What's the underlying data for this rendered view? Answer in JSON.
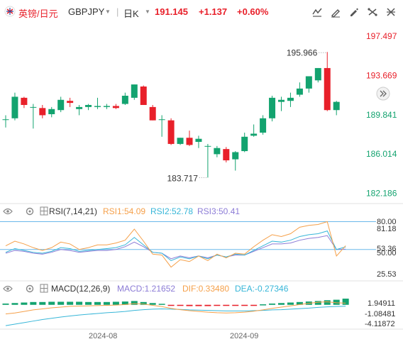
{
  "header": {
    "pair_cn": "英镑/日元",
    "symbol": "GBPJPY",
    "period": "日K",
    "price": "191.145",
    "change": "+1.137",
    "change_pct": "+0.60%"
  },
  "colors": {
    "up": "#13a36f",
    "down": "#e8202a",
    "header_red": "#e8202a",
    "price_axis_up": "#13a36f",
    "price_axis_down": "#e8202a",
    "rsi1": "#f5a04a",
    "rsi2": "#37b6d8",
    "rsi3": "#8c7cd6",
    "rsi_line": "#6ab8ea",
    "dif": "#f5a04a",
    "dea": "#37b6d8"
  },
  "price_axis": {
    "ticks": [
      "197.497",
      "193.669",
      "189.841",
      "186.014",
      "182.186"
    ],
    "high_label": "195.966",
    "low_label": "183.717"
  },
  "rsi_panel": {
    "title": "RSI(7,14,21)",
    "rsi1_label": "RSI1:54.09",
    "rsi2_label": "RSI2:52.78",
    "rsi3_label": "RSI3:50.41",
    "ticks": [
      "80.00",
      "81.18",
      "53.36",
      "50.00",
      "25.53"
    ]
  },
  "macd_panel": {
    "title": "MACD(12,26,9)",
    "macd_label": "MACD:1.21652",
    "dif_label": "DIF:0.33480",
    "dea_label": "DEA:-0.27346",
    "ticks": [
      "1.94911",
      "-1.08481",
      "-4.11872"
    ]
  },
  "x_axis": {
    "labels": [
      "2024-08",
      "2024-09"
    ]
  },
  "chart_data": {
    "type": "candlestick",
    "symbol": "GBPJPY",
    "candles": [
      {
        "o": 189.4,
        "h": 189.8,
        "l": 188.6,
        "c": 189.4
      },
      {
        "o": 189.5,
        "h": 192.0,
        "l": 189.3,
        "c": 191.6
      },
      {
        "o": 191.5,
        "h": 191.6,
        "l": 190.5,
        "c": 190.8
      },
      {
        "o": 190.6,
        "h": 190.9,
        "l": 188.5,
        "c": 190.6
      },
      {
        "o": 190.5,
        "h": 190.8,
        "l": 189.5,
        "c": 189.8
      },
      {
        "o": 189.9,
        "h": 190.6,
        "l": 189.6,
        "c": 190.4
      },
      {
        "o": 190.3,
        "h": 191.6,
        "l": 190.1,
        "c": 191.3
      },
      {
        "o": 191.2,
        "h": 191.5,
        "l": 190.6,
        "c": 191.0
      },
      {
        "o": 190.4,
        "h": 190.8,
        "l": 189.8,
        "c": 190.6
      },
      {
        "o": 190.6,
        "h": 190.9,
        "l": 190.3,
        "c": 190.8
      },
      {
        "o": 190.6,
        "h": 191.5,
        "l": 190.4,
        "c": 190.7
      },
      {
        "o": 190.6,
        "h": 190.9,
        "l": 190.4,
        "c": 190.7
      },
      {
        "o": 190.7,
        "h": 190.9,
        "l": 190.4,
        "c": 190.5
      },
      {
        "o": 190.9,
        "h": 192.0,
        "l": 190.8,
        "c": 191.7
      },
      {
        "o": 191.5,
        "h": 192.8,
        "l": 191.3,
        "c": 192.8
      },
      {
        "o": 192.6,
        "h": 192.7,
        "l": 190.8,
        "c": 190.8
      },
      {
        "o": 190.6,
        "h": 190.8,
        "l": 189.3,
        "c": 189.3
      },
      {
        "o": 189.4,
        "h": 189.8,
        "l": 187.7,
        "c": 189.4
      },
      {
        "o": 189.3,
        "h": 189.5,
        "l": 186.9,
        "c": 187.0
      },
      {
        "o": 187.0,
        "h": 187.6,
        "l": 186.9,
        "c": 187.6
      },
      {
        "o": 187.6,
        "h": 188.3,
        "l": 186.8,
        "c": 186.9
      },
      {
        "o": 187.2,
        "h": 187.8,
        "l": 186.6,
        "c": 187.5
      },
      {
        "o": 186.8,
        "h": 187.0,
        "l": 183.717,
        "c": 186.8
      },
      {
        "o": 186.0,
        "h": 186.8,
        "l": 185.7,
        "c": 186.6
      },
      {
        "o": 186.5,
        "h": 186.7,
        "l": 185.2,
        "c": 185.4
      },
      {
        "o": 185.5,
        "h": 186.3,
        "l": 184.4,
        "c": 186.2
      },
      {
        "o": 186.3,
        "h": 188.1,
        "l": 186.2,
        "c": 187.7
      },
      {
        "o": 187.8,
        "h": 188.9,
        "l": 187.7,
        "c": 188.0
      },
      {
        "o": 188.1,
        "h": 189.8,
        "l": 187.9,
        "c": 189.5
      },
      {
        "o": 189.5,
        "h": 191.7,
        "l": 189.2,
        "c": 191.5
      },
      {
        "o": 191.1,
        "h": 191.6,
        "l": 190.2,
        "c": 191.3
      },
      {
        "o": 191.2,
        "h": 192.0,
        "l": 190.6,
        "c": 191.5
      },
      {
        "o": 191.8,
        "h": 193.0,
        "l": 191.6,
        "c": 192.4
      },
      {
        "o": 192.4,
        "h": 193.6,
        "l": 192.0,
        "c": 193.6
      },
      {
        "o": 193.2,
        "h": 194.4,
        "l": 193.0,
        "c": 194.4
      },
      {
        "o": 194.4,
        "h": 195.966,
        "l": 190.2,
        "c": 190.3
      },
      {
        "o": 190.3,
        "h": 191.2,
        "l": 189.8,
        "c": 191.1
      }
    ],
    "rsi": {
      "ylim": [
        20,
        85
      ],
      "rsi1": [
        54,
        59,
        56,
        52,
        49,
        52,
        58,
        56,
        50,
        52,
        55,
        55,
        57,
        60,
        72,
        59,
        45,
        44,
        31,
        39,
        37,
        43,
        38,
        45,
        41,
        46,
        45,
        53,
        60,
        66,
        64,
        67,
        74,
        76,
        77,
        80,
        43,
        54.09
      ],
      "rsi2": [
        47,
        51,
        49,
        47,
        46,
        48,
        52,
        51,
        48,
        49,
        50,
        51,
        52,
        55,
        63,
        55,
        47,
        46,
        38,
        42,
        40,
        43,
        40,
        44,
        42,
        45,
        44,
        49,
        54,
        59,
        58,
        60,
        64,
        66,
        67,
        70,
        50,
        52.78
      ],
      "rsi3": [
        46,
        49,
        48,
        46,
        45,
        47,
        50,
        49,
        47,
        48,
        49,
        49,
        50,
        53,
        58,
        53,
        47,
        46,
        40,
        43,
        41,
        43,
        41,
        44,
        42,
        44,
        44,
        48,
        52,
        56,
        56,
        57,
        60,
        62,
        63,
        65,
        50,
        50.41
      ],
      "lines": [
        80,
        50
      ]
    },
    "macd": {
      "ylim": [
        -4.5,
        2.2
      ],
      "hist": [
        0.25,
        0.35,
        0.45,
        0.55,
        0.55,
        0.6,
        0.6,
        0.6,
        0.6,
        0.55,
        0.55,
        0.55,
        0.6,
        0.65,
        0.75,
        0.55,
        0.35,
        0.2,
        -0.05,
        -0.15,
        -0.25,
        -0.25,
        -0.25,
        -0.2,
        -0.2,
        -0.2,
        -0.1,
        -0.05,
        0.1,
        0.25,
        0.35,
        0.45,
        0.55,
        0.65,
        0.75,
        0.9,
        1.0,
        1.21652
      ],
      "dif": [
        -1.8,
        -1.6,
        -1.3,
        -1.0,
        -0.8,
        -0.6,
        -0.45,
        -0.3,
        -0.25,
        -0.2,
        -0.15,
        -0.1,
        -0.05,
        0.05,
        0.25,
        0.15,
        -0.1,
        -0.35,
        -0.7,
        -0.95,
        -1.15,
        -1.3,
        -1.45,
        -1.55,
        -1.6,
        -1.55,
        -1.45,
        -1.25,
        -1.0,
        -0.7,
        -0.45,
        -0.2,
        0.05,
        0.3,
        0.5,
        0.6,
        0.4,
        0.3348
      ],
      "dea": [
        -4.1,
        -3.8,
        -3.5,
        -3.2,
        -2.9,
        -2.65,
        -2.4,
        -2.2,
        -2.0,
        -1.85,
        -1.7,
        -1.55,
        -1.45,
        -1.3,
        -1.1,
        -0.95,
        -0.85,
        -0.8,
        -0.85,
        -0.9,
        -1.0,
        -1.05,
        -1.1,
        -1.15,
        -1.2,
        -1.2,
        -1.2,
        -1.15,
        -1.1,
        -1.0,
        -0.95,
        -0.85,
        -0.75,
        -0.65,
        -0.5,
        -0.4,
        -0.33,
        -0.27346
      ]
    },
    "ylim": [
      181.6,
      198.2
    ],
    "price_ticks": [
      197.497,
      193.669,
      189.841,
      186.014,
      182.186
    ],
    "last_price": 191.145
  }
}
